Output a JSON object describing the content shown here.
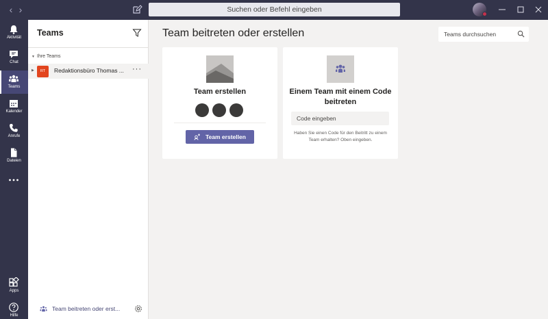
{
  "titlebar": {
    "search_placeholder": "Suchen oder Befehl eingeben"
  },
  "rail": {
    "items": [
      {
        "label": "Aktivität",
        "icon": "bell-icon"
      },
      {
        "label": "Chat",
        "icon": "chat-icon"
      },
      {
        "label": "Teams",
        "icon": "teams-icon",
        "active": true
      },
      {
        "label": "Kalender",
        "icon": "calendar-icon"
      },
      {
        "label": "Anrufe",
        "icon": "phone-icon"
      },
      {
        "label": "Dateien",
        "icon": "file-icon"
      },
      {
        "label": "",
        "icon": "more-icon"
      }
    ],
    "bottom": [
      {
        "label": "Apps",
        "icon": "apps-icon"
      },
      {
        "label": "Hilfe",
        "icon": "help-icon"
      }
    ]
  },
  "panel": {
    "title": "Teams",
    "section_label": "Ihre Teams",
    "team": {
      "initials": "RT",
      "name": "Redaktionsbüro Thomas ...",
      "more": "···"
    },
    "footer_label": "Team beitreten oder erst..."
  },
  "main": {
    "title": "Team beitreten oder erstellen",
    "search_placeholder": "Teams durchsuchen",
    "create_card": {
      "title": "Team erstellen",
      "button_label": "Team erstellen"
    },
    "join_card": {
      "title": "Einem Team mit einem Code beitreten",
      "input_placeholder": "Code eingeben",
      "help_text": "Haben Sie einen Code für den Beitritt zu einem Team erhalten? Oben eingeben."
    }
  },
  "colors": {
    "rail_bg": "#33344a",
    "accent": "#6264a7",
    "team_avatar": "#e2451e",
    "presence_busy": "#c4314b"
  }
}
